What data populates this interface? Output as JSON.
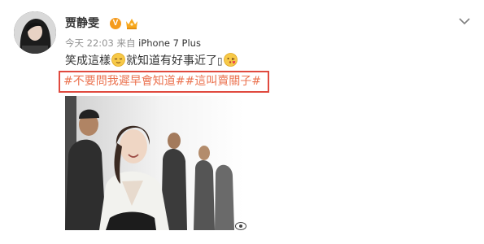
{
  "post": {
    "username": "贾静雯",
    "verified_badge": "V",
    "timestamp": "今天 22:03",
    "source_prefix": "来自",
    "source": "iPhone 7 Plus",
    "text_part1": "笑成這樣",
    "text_part2": "就知道有好事近了",
    "placeholder_char": "▯",
    "hashtag1": "#不要問我遲早會知道#",
    "hashtag2": "#這叫賣關子#",
    "icons": {
      "options": "chevron-down-icon",
      "verified": "verified-v-icon",
      "membership": "crown-icon",
      "emoji1": "relieved-face-icon",
      "emoji2": "kissing-face-icon",
      "watermark": "weibo-eye-icon"
    },
    "colors": {
      "hashtag": "#eb7350",
      "highlight_box": "#e04a3f",
      "verified": "#f59b1d",
      "meta": "#939393"
    }
  }
}
